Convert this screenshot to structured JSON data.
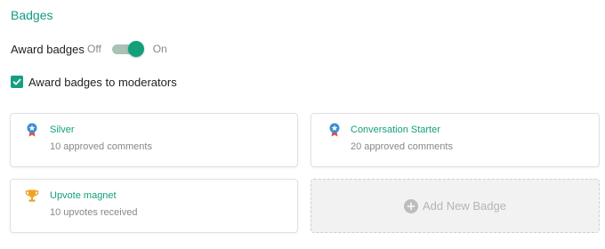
{
  "section_title": "Badges",
  "award_toggle": {
    "label": "Award badges",
    "off_label": "Off",
    "on_label": "On",
    "state": "on"
  },
  "moderators_checkbox": {
    "label": "Award badges to moderators",
    "checked": true
  },
  "badges": [
    {
      "name": "Silver",
      "description": "10 approved comments",
      "icon": "silver-medal-icon"
    },
    {
      "name": "Conversation Starter",
      "description": "20 approved comments",
      "icon": "blue-medal-icon"
    },
    {
      "name": "Upvote magnet",
      "description": "10 upvotes received",
      "icon": "trophy-icon"
    }
  ],
  "add_badge_label": "Add New Badge",
  "colors": {
    "accent": "#12a07a",
    "medal_blue": "#3a8fd6",
    "ribbon_red": "#d9534f",
    "trophy_gold": "#f0a229"
  }
}
